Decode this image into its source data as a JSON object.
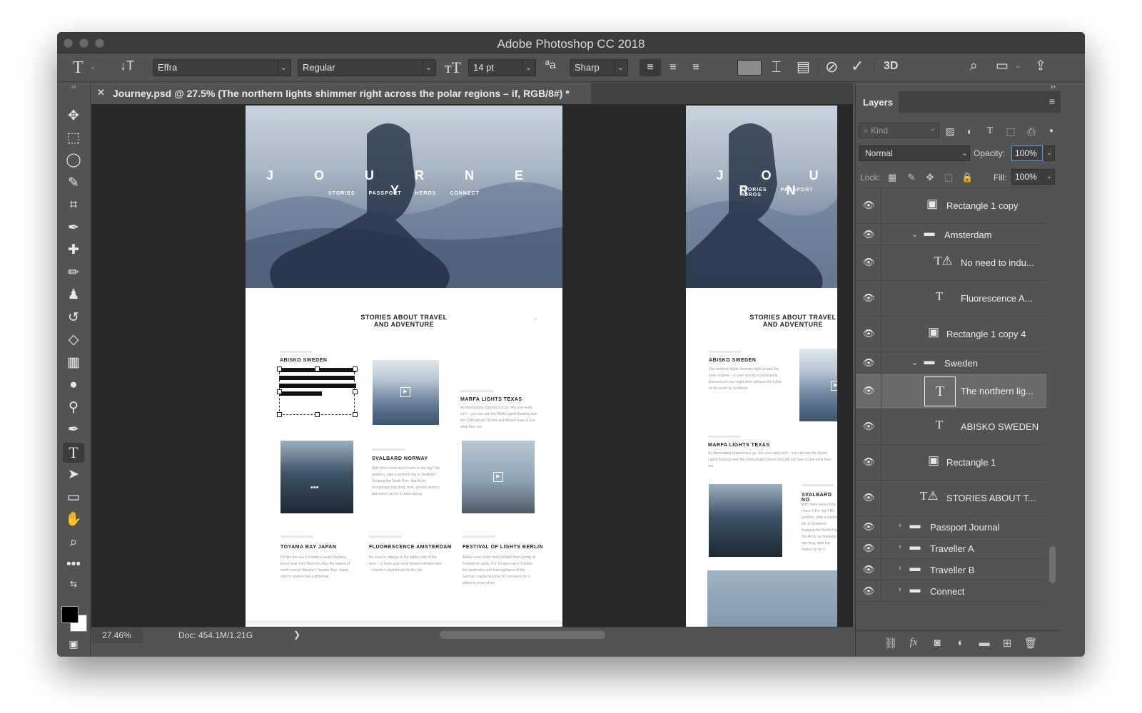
{
  "window": {
    "title": "Adobe Photoshop CC 2018"
  },
  "options_bar": {
    "tool_icon": "type-tool-icon",
    "font_family": "Effra",
    "font_style": "Regular",
    "font_size": "14 pt",
    "antialias_prefix": "ªa",
    "antialias": "Sharp",
    "threed_label": "3D"
  },
  "document": {
    "tab_title": "Journey.psd @ 27.5% (The northern lights shimmer right across the polar regions – if, RGB/8#) *"
  },
  "artboard_main": {
    "hero_title": "J O U R N E Y",
    "nav": [
      "STORIES",
      "PASSPORT",
      "HEROS",
      "CONNECT"
    ],
    "section_title_line1": "STORIES ABOUT TRAVEL",
    "section_title_line2": "AND ADVENTURE",
    "cards": [
      {
        "title": "ABISKO SWEDEN",
        "text": "The northern lights shimmer right across the polar regions – if solar activity is particularly pronounced you might even glimpse the lights as far south as Scotland."
      },
      {
        "title": "MARFA LIGHTS TEXAS",
        "text": "As illuminating experiences go, this one really isn't – you can see the Marfa Lights flashing over the Chihuahuan Desert and still not have a clue what they are."
      },
      {
        "title": "SVALBARD NORWAY",
        "text": "With there were more hours in the day? No problem, plan a summer trip to Svalbard. Nudging the North Pole, this Arctic archipelago has long, dark, ghostly winters but makes up for it come spring."
      },
      {
        "title": "TOYAMA BAY JAPAN",
        "text": "It's like the sea is having a really big party. Every year from March to May the waters of north-central Honshu's Toyama Bay, Japan, start to sparkle like a glitterball."
      },
      {
        "title": "FLUORESCENCE AMSTERDAM",
        "text": "No need to indulge in the lighter side of life here – to have your mind blown in Amsterdam – Electric Ladyland will do the job."
      },
      {
        "title": "FESTIVAL OF LIGHTS BERLIN",
        "text": "Berlin never looks more brilliant than during its Festival of Lights. For 10 days each October, the landmarks and thoroughfares of the German capital become 3D canvases for a glittering array of art."
      }
    ]
  },
  "artboard_side": {
    "hero_title": "J O U R N",
    "nav": [
      "STORIES",
      "PASSPORT",
      "HEROS"
    ],
    "section_title_line1": "STORIES ABOUT TRAVEL",
    "section_title_line2": "AND ADVENTURE",
    "card1_title": "ABISKO SWEDEN",
    "card1_text": "The northern lights shimmer right across the polar regions – if solar activity is particularly pronounced you might even glimpse the lights as far south as Scotland.",
    "card2_title": "MARFA LIGHTS TEXAS",
    "card2_text": "As illuminating experiences go, this one really isn't – you can see the Marfa Lights flashing over the Chihuahuan Desert and still not have a clue what they are.",
    "card3_title": "SVALBARD NO",
    "card3_text": "With there were more hours in the day? No problem, plan a summer trip to Svalbard. Nudging the North Pole, this Arctic archipelago has long, dark but makes up for it."
  },
  "status_bar": {
    "zoom": "27.46%",
    "doc_size": "Doc: 454.1M/1.21G",
    "arrow": "❯"
  },
  "layers_panel": {
    "tab": "Layers",
    "kind_placeholder": "Kind",
    "blend_mode": "Normal",
    "opacity_label": "Opacity:",
    "opacity_value": "100%",
    "lock_label": "Lock:",
    "fill_label": "Fill:",
    "fill_value": "100%",
    "layers": [
      {
        "name": "Rectangle 1 copy",
        "type": "shape"
      },
      {
        "name": "Amsterdam",
        "type": "group-open"
      },
      {
        "name": "No need to indu...",
        "type": "text-warning"
      },
      {
        "name": "Fluorescence A...",
        "type": "text"
      },
      {
        "name": "Rectangle 1 copy 4",
        "type": "shape"
      },
      {
        "name": "Sweden",
        "type": "group-open"
      },
      {
        "name": "The northern lig...",
        "type": "text-selected"
      },
      {
        "name": "ABISKO SWEDEN",
        "type": "text"
      },
      {
        "name": "Rectangle 1",
        "type": "shape"
      },
      {
        "name": "STORIES ABOUT T...",
        "type": "text-warning"
      },
      {
        "name": "Passport Journal",
        "type": "group-closed"
      },
      {
        "name": "Traveller A",
        "type": "group-closed"
      },
      {
        "name": "Traveller B",
        "type": "group-closed"
      },
      {
        "name": "Connect",
        "type": "group-closed"
      }
    ]
  },
  "colors": {
    "ui_background": "#535353",
    "canvas_background": "#282828",
    "selected_layer": "#6b6b6b",
    "focus_ring": "#5a9cf0",
    "foreground_color": "#000000",
    "background_color": "#ffffff"
  }
}
